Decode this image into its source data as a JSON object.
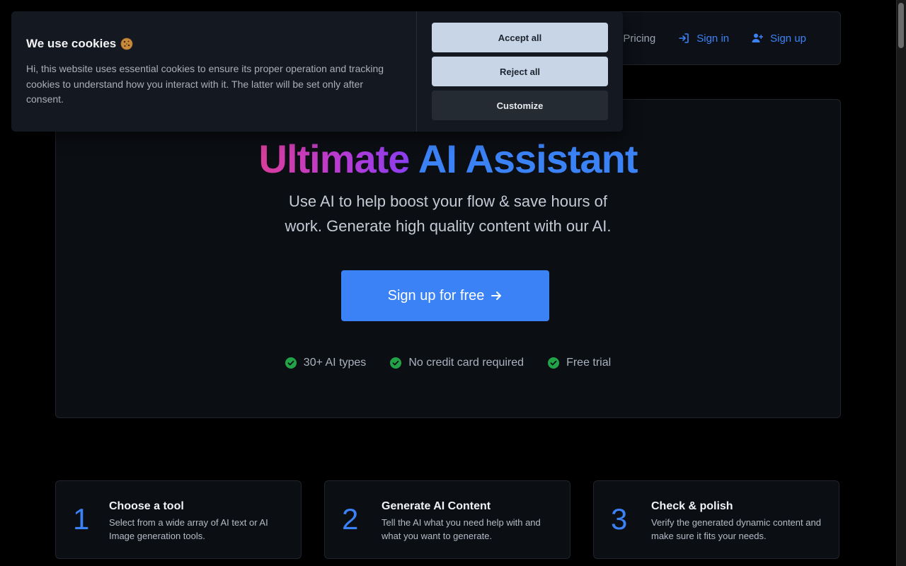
{
  "nav": {
    "pricing": "Pricing",
    "sign_in": "Sign in",
    "sign_up": "Sign up"
  },
  "hero": {
    "title_part1": "Ultimate",
    "title_part2": "AI Assistant",
    "subtitle": "Use AI to help boost your flow & save hours of work. Generate high quality content with our AI.",
    "cta": "Sign up for free",
    "features": [
      "30+ AI types",
      "No credit card required",
      "Free trial"
    ]
  },
  "steps": [
    {
      "num": "1",
      "title": "Choose a tool",
      "desc": "Select from a wide array of AI text or AI Image generation tools."
    },
    {
      "num": "2",
      "title": "Generate AI Content",
      "desc": "Tell the AI what you need help with and what you want to generate."
    },
    {
      "num": "3",
      "title": "Check & polish",
      "desc": "Verify the generated dynamic content and make sure it fits your needs."
    }
  ],
  "cookie": {
    "title": "We use cookies",
    "description": "Hi, this website uses essential cookies to ensure its proper operation and tracking cookies to understand how you interact with it. The latter will be set only after consent.",
    "accept": "Accept all",
    "reject": "Reject all",
    "customize": "Customize"
  },
  "icons": {
    "sign_in": "sign-in-icon",
    "sign_up": "user-plus-icon",
    "arrow": "arrow-right-icon",
    "check": "check-circle-icon",
    "cookie": "cookie-icon"
  },
  "colors": {
    "accent": "#3b82f6",
    "check": "#22a348",
    "gradient_start": "#d83d9a",
    "gradient_end": "#8a3ef0"
  }
}
